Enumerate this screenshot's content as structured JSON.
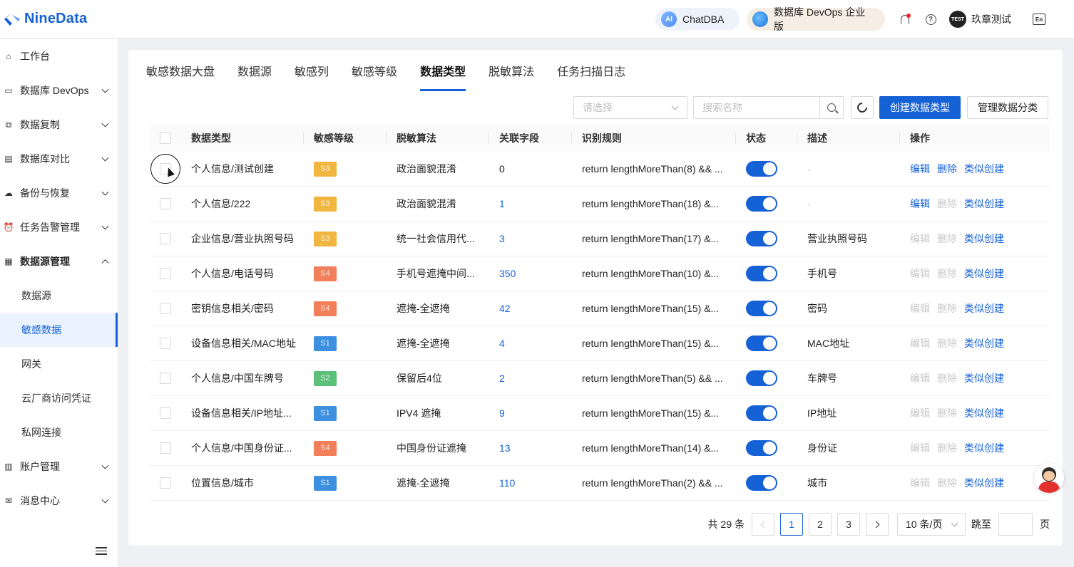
{
  "app": {
    "name": "NineData"
  },
  "header": {
    "chatdba_label": "ChatDBA",
    "chatdba_icon": "ai-icon",
    "edition_label": "数据库 DevOps 企业版",
    "avatar_text": "TEST",
    "username": "玖章测试"
  },
  "sidebar": {
    "items": [
      {
        "label": "工作台",
        "icon": "home-icon"
      },
      {
        "label": "数据库 DevOps",
        "icon": "monitor-icon"
      },
      {
        "label": "数据复制",
        "icon": "copy-icon"
      },
      {
        "label": "数据库对比",
        "icon": "compare-icon"
      },
      {
        "label": "备份与恢复",
        "icon": "cloud-icon"
      },
      {
        "label": "任务告警管理",
        "icon": "alarm-icon"
      },
      {
        "label": "数据源管理",
        "icon": "database-icon"
      }
    ],
    "subitems": [
      {
        "label": "数据源"
      },
      {
        "label": "敏感数据"
      },
      {
        "label": "网关"
      },
      {
        "label": "云厂商访问凭证"
      },
      {
        "label": "私网连接"
      }
    ],
    "bottom_items": [
      {
        "label": "账户管理",
        "icon": "account-icon"
      },
      {
        "label": "消息中心",
        "icon": "mail-icon"
      }
    ]
  },
  "tabs": [
    "敏感数据大盘",
    "数据源",
    "敏感列",
    "敏感等级",
    "数据类型",
    "脱敏算法",
    "任务扫描日志"
  ],
  "active_tab": "数据类型",
  "toolbar": {
    "select_placeholder": "请选择",
    "search_placeholder": "搜索名称",
    "create_label": "创建数据类型",
    "manage_label": "管理数据分类"
  },
  "table": {
    "headers": [
      "数据类型",
      "敏感等级",
      "脱敏算法",
      "关联字段",
      "识别规则",
      "状态",
      "描述",
      "操作"
    ],
    "rows": [
      {
        "type": "个人信息/测试创建",
        "level": "S3",
        "level_color": "#f0b63f",
        "algorithm": "政治面貌混淆",
        "fields": "0",
        "fields_link": false,
        "rule": "return lengthMoreThan(8) && ...",
        "desc": "-",
        "edit_enabled": true,
        "delete_enabled": true
      },
      {
        "type": "个人信息/222",
        "level": "S3",
        "level_color": "#f0b63f",
        "algorithm": "政治面貌混淆",
        "fields": "1",
        "fields_link": true,
        "rule": "return lengthMoreThan(18) &...",
        "desc": "-",
        "edit_enabled": true,
        "delete_enabled": false
      },
      {
        "type": "企业信息/营业执照号码",
        "level": "S3",
        "level_color": "#f0b63f",
        "algorithm": "统一社会信用代...",
        "fields": "3",
        "fields_link": true,
        "rule": "return lengthMoreThan(17) &...",
        "desc": "营业执照号码",
        "edit_enabled": false,
        "delete_enabled": false
      },
      {
        "type": "个人信息/电话号码",
        "level": "S4",
        "level_color": "#f07f5a",
        "algorithm": "手机号遮掩中间...",
        "fields": "350",
        "fields_link": true,
        "rule": "return lengthMoreThan(10) &...",
        "desc": "手机号",
        "edit_enabled": false,
        "delete_enabled": false
      },
      {
        "type": "密钥信息相关/密码",
        "level": "S4",
        "level_color": "#f07f5a",
        "algorithm": "遮掩-全遮掩",
        "fields": "42",
        "fields_link": true,
        "rule": "return lengthMoreThan(15) &...",
        "desc": "密码",
        "edit_enabled": false,
        "delete_enabled": false
      },
      {
        "type": "设备信息相关/MAC地址",
        "level": "S1",
        "level_color": "#3d8fe0",
        "algorithm": "遮掩-全遮掩",
        "fields": "4",
        "fields_link": true,
        "rule": "return lengthMoreThan(15) &...",
        "desc": "MAC地址",
        "edit_enabled": false,
        "delete_enabled": false
      },
      {
        "type": "个人信息/中国车牌号",
        "level": "S2",
        "level_color": "#5cc07a",
        "algorithm": "保留后4位",
        "fields": "2",
        "fields_link": true,
        "rule": "return lengthMoreThan(5) && ...",
        "desc": "车牌号",
        "edit_enabled": false,
        "delete_enabled": false
      },
      {
        "type": "设备信息相关/IP地址...",
        "level": "S1",
        "level_color": "#3d8fe0",
        "algorithm": "IPV4 遮掩",
        "fields": "9",
        "fields_link": true,
        "rule": "return lengthMoreThan(15) &...",
        "desc": "IP地址",
        "edit_enabled": false,
        "delete_enabled": false
      },
      {
        "type": "个人信息/中国身份证...",
        "level": "S4",
        "level_color": "#f07f5a",
        "algorithm": "中国身份证遮掩",
        "fields": "13",
        "fields_link": true,
        "rule": "return lengthMoreThan(14) &...",
        "desc": "身份证",
        "edit_enabled": false,
        "delete_enabled": false
      },
      {
        "type": "位置信息/城市",
        "level": "S1",
        "level_color": "#3d8fe0",
        "algorithm": "遮掩-全遮掩",
        "fields": "110",
        "fields_link": true,
        "rule": "return lengthMoreThan(2) && ...",
        "desc": "城市",
        "edit_enabled": false,
        "delete_enabled": false
      }
    ],
    "op_labels": {
      "edit": "编辑",
      "delete": "删除",
      "clone": "类似创建"
    }
  },
  "pagination": {
    "total_label": "共 29 条",
    "pages": [
      "1",
      "2",
      "3"
    ],
    "current_page": "1",
    "page_size": "10 条/页",
    "jump_label": "跳至",
    "page_suffix": "页"
  },
  "colors": {
    "primary": "#1561d6",
    "brand": "#1561d6"
  }
}
